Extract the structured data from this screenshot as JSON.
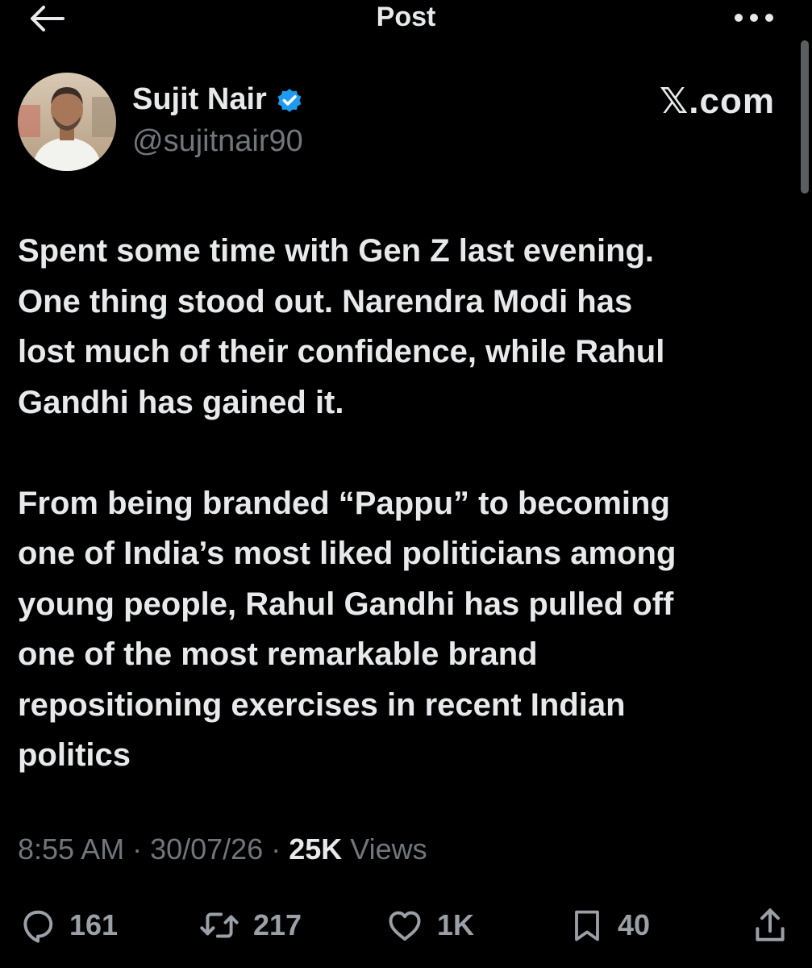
{
  "header": {
    "title": "Post"
  },
  "author": {
    "display_name": "Sujit Nair",
    "handle": "@sujitnair90",
    "verified": true
  },
  "watermark": "𝕏.com",
  "tweet": {
    "text": "Spent some time with Gen Z last evening.\nOne thing stood out. Narendra Modi has\nlost much of their confidence, while Rahul\nGandhi has gained it.\n\nFrom being branded “Pappu” to becoming\none of India’s most liked politicians among\nyoung people, Rahul Gandhi has pulled off\none of the most remarkable brand\nrepositioning exercises in recent Indian\npolitics"
  },
  "meta": {
    "time": "8:55 AM",
    "sep1": " · ",
    "date": "30/07/26",
    "sep2": " · ",
    "views_count": "25K",
    "views_label": " Views"
  },
  "actions": {
    "replies": "161",
    "reposts": "217",
    "likes": "1K",
    "bookmarks": "40"
  },
  "icons": {
    "back": "arrow-left-icon",
    "more": "more-horizontal-icon",
    "verified": "verified-badge-icon",
    "reply": "reply-icon",
    "repost": "repost-icon",
    "like": "heart-icon",
    "bookmark": "bookmark-icon",
    "share": "share-icon"
  },
  "colors": {
    "background": "#000000",
    "text": "#e7e9ea",
    "secondary": "#71767b",
    "verified": "#1d9bf0"
  }
}
